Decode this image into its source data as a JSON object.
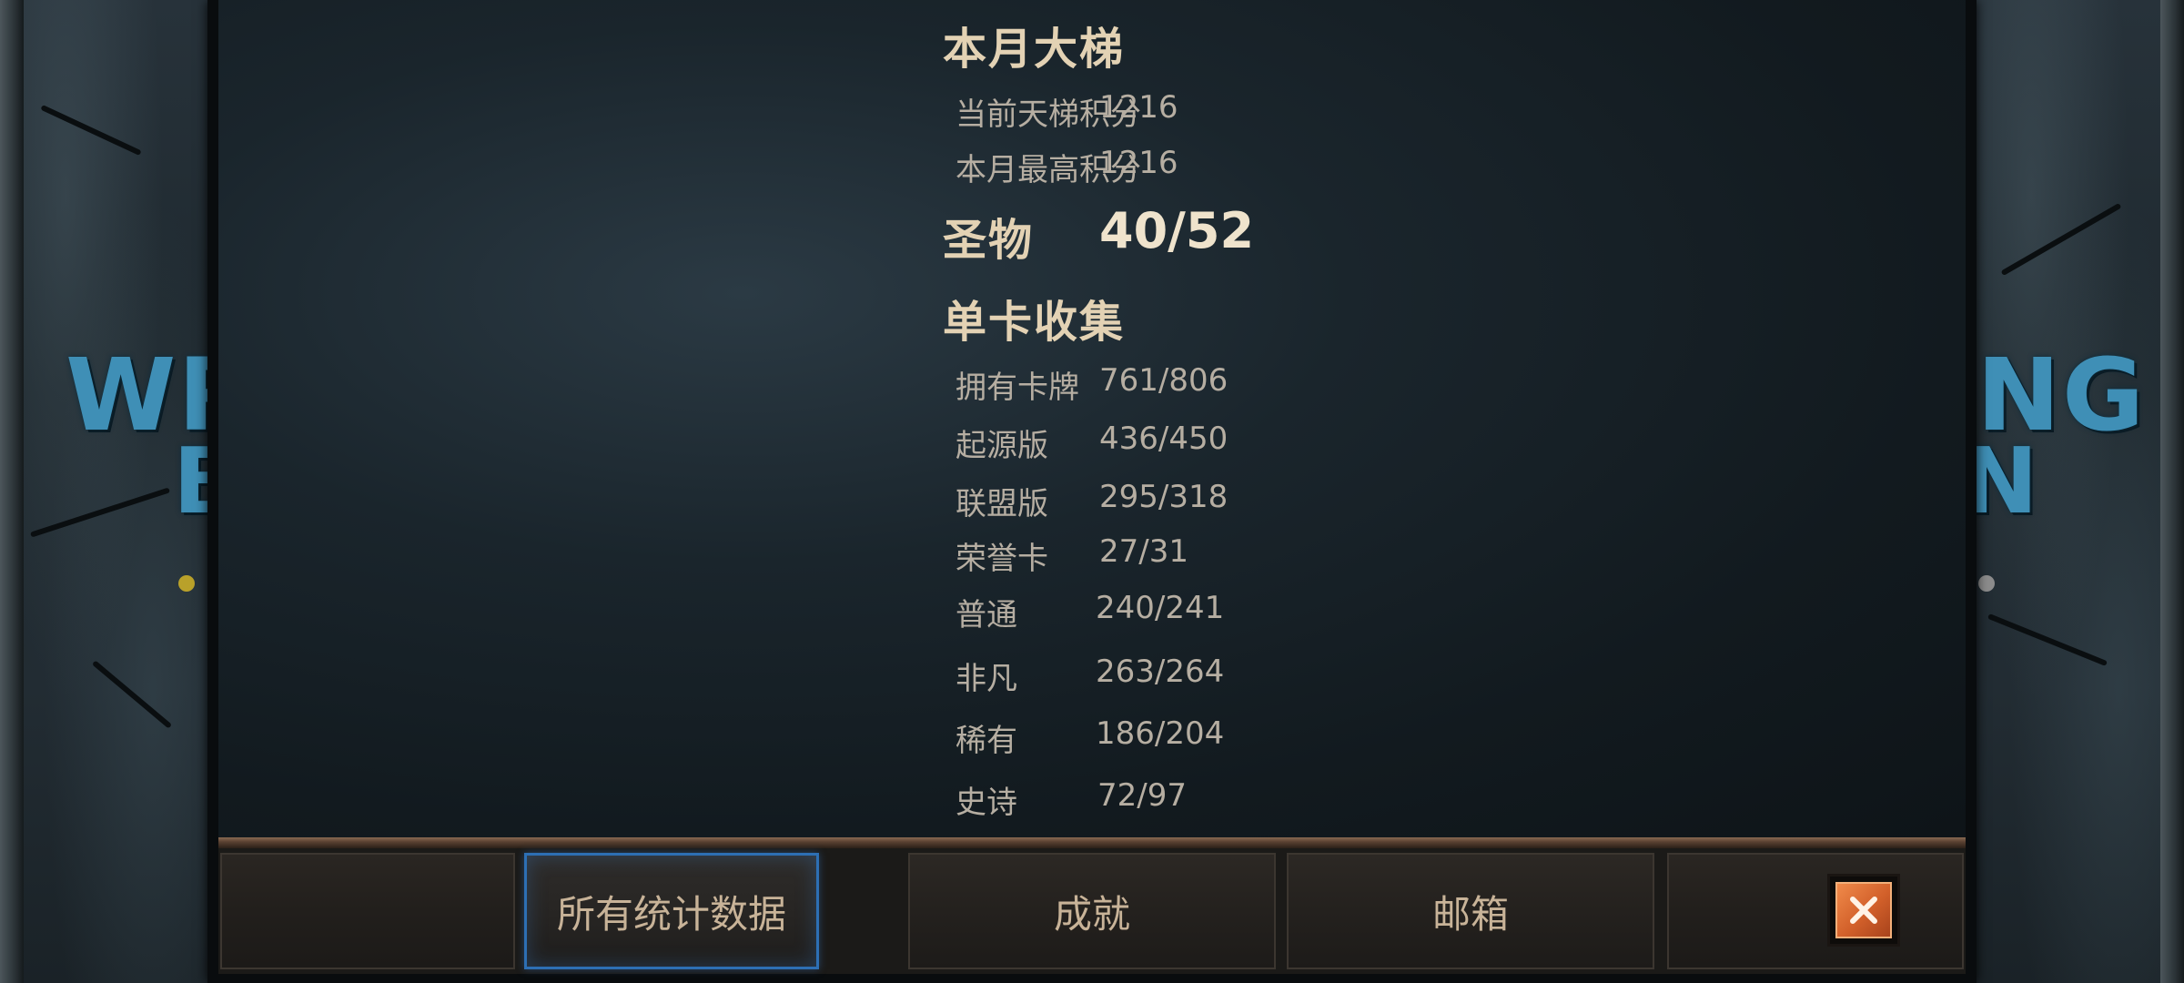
{
  "background": {
    "logo_left": "WR",
    "logo_left_sub": "B",
    "logo_right": "NG",
    "logo_right_sub": "N"
  },
  "sections": {
    "ladder": {
      "title": "本月大梯",
      "rows": [
        {
          "label": "当前天梯积分",
          "value": "1216"
        },
        {
          "label": "本月最高积分",
          "value": "1216"
        }
      ]
    },
    "relics": {
      "title": "圣物",
      "value": "40/52"
    },
    "collection": {
      "title": "单卡收集",
      "rows": [
        {
          "label": "拥有卡牌",
          "value": "761/806"
        },
        {
          "label": "起源版",
          "value": "436/450"
        },
        {
          "label": "联盟版",
          "value": "295/318"
        },
        {
          "label": "荣誉卡",
          "value": "27/31"
        },
        {
          "label": "普通",
          "value": "240/241"
        },
        {
          "label": "非凡",
          "value": "263/264"
        },
        {
          "label": "稀有",
          "value": "186/204"
        },
        {
          "label": "史诗",
          "value": "72/97"
        }
      ]
    }
  },
  "tabs": [
    {
      "label": "所有统计数据",
      "active": true
    },
    {
      "label": "成就",
      "active": false
    },
    {
      "label": "邮箱",
      "active": false
    }
  ],
  "close_icon": "close-x-icon",
  "colors": {
    "active_tab_border": "#2d6fb4",
    "close_button": "#d2602a",
    "title_text": "#e3d2b4",
    "row_text": "#b6aea2"
  }
}
